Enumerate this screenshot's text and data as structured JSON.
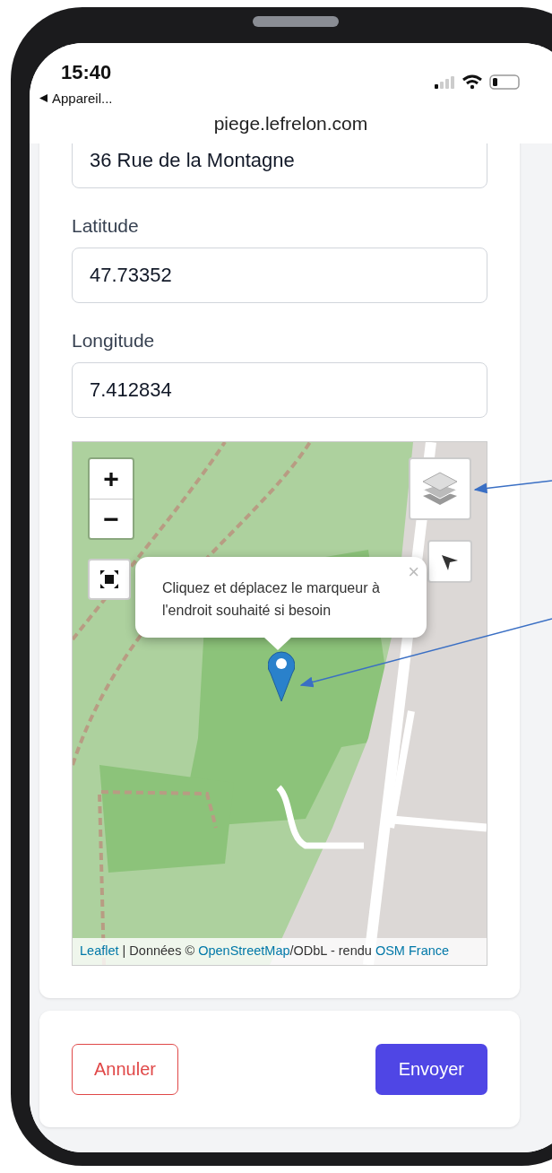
{
  "status_bar": {
    "time": "15:40",
    "back_label": "Appareil..."
  },
  "browser": {
    "url": "piege.lefrelon.com"
  },
  "form": {
    "fields": [
      {
        "value": "36 Rue de la Montagne"
      },
      {
        "label": "Latitude",
        "value": "47.73352"
      },
      {
        "label": "Longitude",
        "value": "7.412834"
      }
    ],
    "map": {
      "zoom_in": "+",
      "zoom_out": "−",
      "popup": {
        "text": "Cliquez et déplacez le marqueur à l'endroit souhaité si besoin",
        "close": "×"
      },
      "attribution": [
        {
          "text": "Leaflet",
          "kind": "link"
        },
        {
          "text": " | Données © ",
          "kind": "text"
        },
        {
          "text": "OpenStreetMap",
          "kind": "link"
        },
        {
          "text": "/ODbL - rendu ",
          "kind": "text"
        },
        {
          "text": "OSM France",
          "kind": "link"
        }
      ]
    }
  },
  "actions": [
    {
      "label": "Annuler",
      "kind": "secondary"
    },
    {
      "label": "Envoyer",
      "kind": "primary"
    }
  ]
}
